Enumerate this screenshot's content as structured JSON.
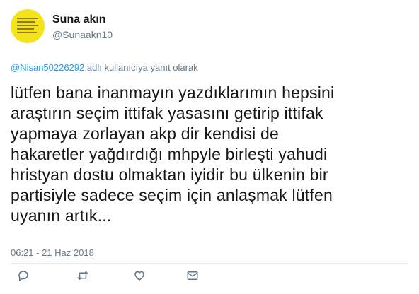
{
  "user": {
    "display_name": "Suna akın",
    "handle": "@Sunaakn10"
  },
  "reply": {
    "mention": "@Nisan50226292",
    "suffix": " adlı kullanıcıya yanıt olarak"
  },
  "tweet": {
    "lines": [
      "lütfen bana inanmayın yazdıklarımın hepsini",
      "araştırın seçim ittifak yasasını getirip ittifak",
      "yapmaya zorlayan akp dir kendisi de",
      "hakaretler yağdırdığı mhpyle birleşti yahudi",
      "hristyan dostu olmaktan iyidir bu ülkenin bir",
      "partisiyle sadece seçim için anlaşmak lütfen",
      "uyanın artık..."
    ],
    "timestamp": "06:21 - 21 Haz 2018"
  },
  "actions": {
    "reply_icon": "reply-icon",
    "retweet_icon": "retweet-icon",
    "like_icon": "heart-icon",
    "dm_icon": "envelope-icon"
  },
  "colors": {
    "text": "#14171a",
    "secondary": "#657786",
    "link": "#1da1f2",
    "avatar_bg": "#f5e31a"
  }
}
